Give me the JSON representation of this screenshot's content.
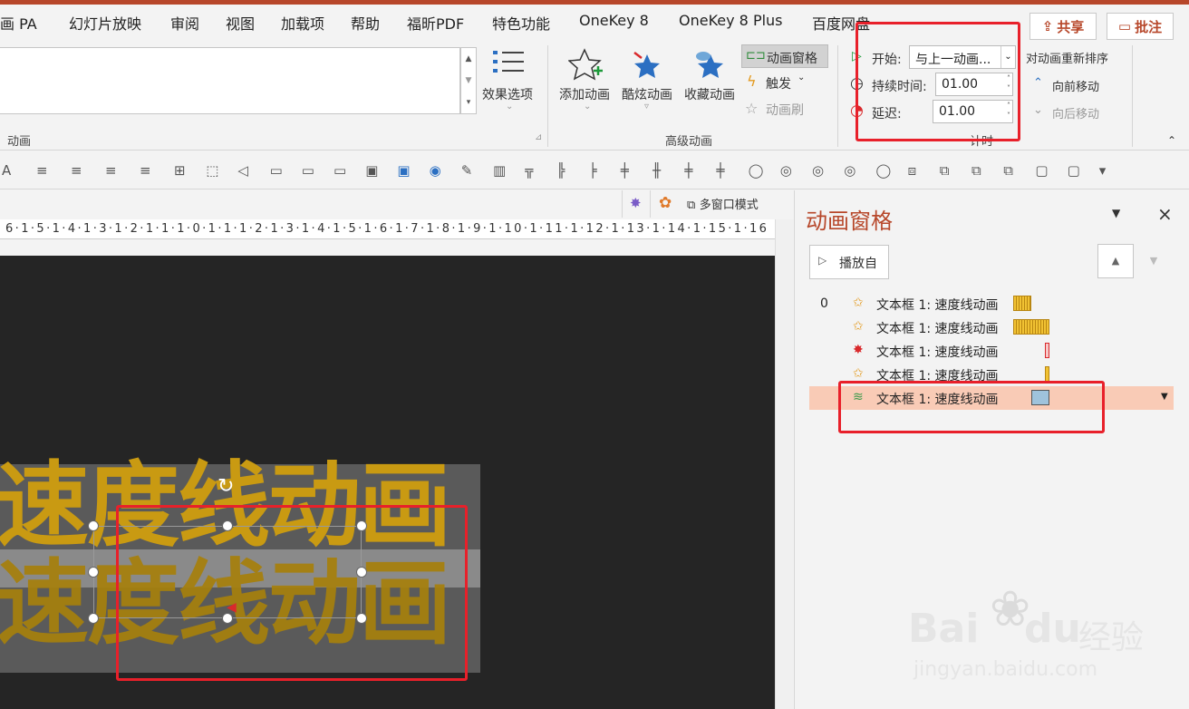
{
  "tabs": [
    "画 PA",
    "幻灯片放映",
    "审阅",
    "视图",
    "加载项",
    "帮助",
    "福昕PDF",
    "特色功能",
    "OneKey 8",
    "OneKey 8 Plus",
    "百度网盘"
  ],
  "share_label": "共享",
  "comment_label": "批注",
  "ribbon": {
    "effect_options": "效果选项",
    "group_animation": "动画",
    "add_animation": "添加动画",
    "cool_animation": "酷炫动画",
    "fav_animation": "收藏动画",
    "animation_pane_btn": "动画窗格",
    "trigger": "触发",
    "anim_painter": "动画刷",
    "group_advanced": "高级动画",
    "start_label": "开始:",
    "start_value": "与上一动画...",
    "duration_label": "持续时间:",
    "duration_value": "01.00",
    "delay_label": "延迟:",
    "delay_value": "01.00",
    "group_timing": "计时",
    "reorder_label": "对动画重新排序",
    "move_earlier": "向前移动",
    "move_later": "向后移动"
  },
  "viewbar": {
    "multi_window": "多窗口模式"
  },
  "ruler_text": "6·1·5·1·4·1·3·1·2·1·1·1·0·1·1·1·2·1·3·1·4·1·5·1·6·1·7·1·8·1·9·1·10·1·11·1·12·1·13·1·14·1·15·1·16",
  "slide": {
    "text": "速度线动画"
  },
  "pane": {
    "title": "动画窗格",
    "play_from": "播放自",
    "index0": "0",
    "items": [
      {
        "label": "文本框 1: 速度线动画",
        "icon": "entrance-star-icon",
        "color": "#e39a1f"
      },
      {
        "label": "文本框 1: 速度线动画",
        "icon": "entrance-star-icon",
        "color": "#e39a1f"
      },
      {
        "label": "文本框 1: 速度线动画",
        "icon": "emphasis-burst-icon",
        "color": "#d9292c"
      },
      {
        "label": "文本框 1: 速度线动画",
        "icon": "entrance-star-icon",
        "color": "#e39a1f"
      },
      {
        "label": "文本框 1: 速度线动画",
        "icon": "motion-path-icon",
        "color": "#3a9a4a"
      }
    ]
  },
  "watermark": {
    "brand": "Bai",
    "brand2": "du",
    "cn": "经验",
    "url": "jingyan.baidu.com"
  }
}
